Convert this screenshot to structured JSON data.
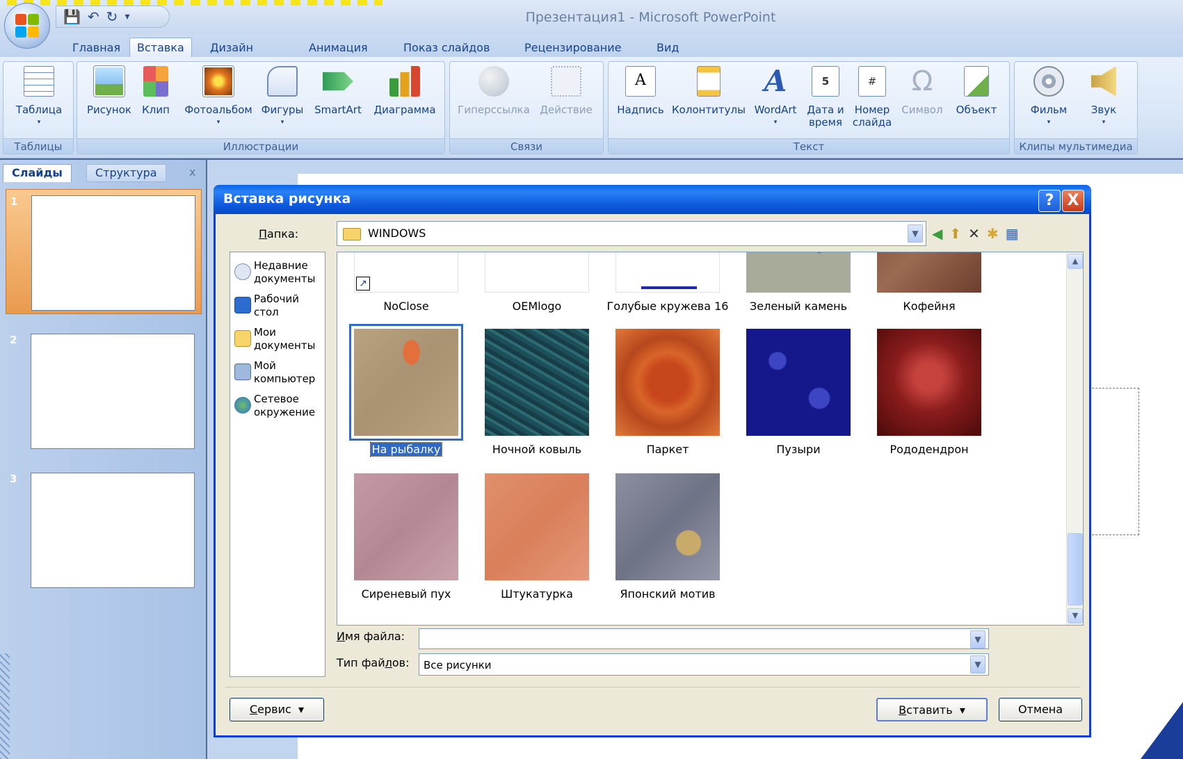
{
  "app": {
    "title": "Презентация1 - Microsoft PowerPoint"
  },
  "qat": {
    "save_icon": "save-icon",
    "undo_icon": "undo-icon",
    "redo_icon": "redo-icon",
    "customize": "▾"
  },
  "tabs": [
    {
      "label": "Главная",
      "active": false
    },
    {
      "label": "Вставка",
      "active": true
    },
    {
      "label": "Дизайн",
      "active": false
    },
    {
      "label": "Анимация",
      "active": false
    },
    {
      "label": "Показ слайдов",
      "active": false
    },
    {
      "label": "Рецензирование",
      "active": false
    },
    {
      "label": "Вид",
      "active": false
    }
  ],
  "ribbon": {
    "groups": [
      {
        "label": "Таблицы",
        "buttons": [
          {
            "label": "Таблица",
            "icon": "table-icon"
          }
        ]
      },
      {
        "label": "Иллюстрации",
        "buttons": [
          {
            "label": "Рисунок",
            "icon": "picture-icon"
          },
          {
            "label": "Клип",
            "icon": "clip-icon"
          },
          {
            "label": "Фотоальбом",
            "icon": "photo-album-icon"
          },
          {
            "label": "Фигуры",
            "icon": "shapes-icon"
          },
          {
            "label": "SmartArt",
            "icon": "smartart-icon"
          },
          {
            "label": "Диаграмма",
            "icon": "chart-icon"
          }
        ]
      },
      {
        "label": "Связи",
        "buttons": [
          {
            "label": "Гиперссылка",
            "icon": "hyperlink-icon"
          },
          {
            "label": "Действие",
            "icon": "action-icon"
          }
        ]
      },
      {
        "label": "Текст",
        "buttons": [
          {
            "label": "Надпись",
            "icon": "textbox-icon"
          },
          {
            "label": "Колонтитулы",
            "icon": "header-footer-icon"
          },
          {
            "label": "WordArt",
            "icon": "wordart-icon"
          },
          {
            "label": "Дата и время",
            "icon": "date-time-icon"
          },
          {
            "label": "Номер слайда",
            "icon": "slide-number-icon"
          },
          {
            "label": "Символ",
            "icon": "symbol-icon"
          },
          {
            "label": "Объект",
            "icon": "object-icon"
          }
        ]
      },
      {
        "label": "Клипы мультимедиа",
        "buttons": [
          {
            "label": "Фильм",
            "icon": "movie-icon"
          },
          {
            "label": "Звук",
            "icon": "sound-icon"
          }
        ]
      }
    ],
    "text_labels": {
      "date_line1": "Дата и",
      "date_line2": "время",
      "num_line1": "Номер",
      "num_line2": "слайда"
    }
  },
  "slides_pane": {
    "tab_slides": "Слайды",
    "tab_outline": "Структура",
    "close": "x",
    "slides": [
      "1",
      "2",
      "3"
    ]
  },
  "dialog": {
    "title": "Вставка рисунка",
    "help": "?",
    "close": "X",
    "folder_label_u": "П",
    "folder_label_rest": "апка:",
    "folder_value": "WINDOWS",
    "places": [
      {
        "label": "Недавние документы",
        "icon": "recent-docs-icon"
      },
      {
        "label": "Рабочий стол",
        "icon": "desktop-icon"
      },
      {
        "label": "Мои документы",
        "icon": "my-documents-icon"
      },
      {
        "label": "Мой компьютер",
        "icon": "my-computer-icon"
      },
      {
        "label": "Сетевое окружение",
        "icon": "network-icon"
      }
    ],
    "files": [
      {
        "name": "NoClose"
      },
      {
        "name": "OEMlogo"
      },
      {
        "name": "Голубые кружева 16"
      },
      {
        "name": "Зеленый камень"
      },
      {
        "name": "Кофейня"
      },
      {
        "name": "На рыбалку",
        "selected": true
      },
      {
        "name": "Ночной ковыль"
      },
      {
        "name": "Паркет"
      },
      {
        "name": "Пузыри"
      },
      {
        "name": "Рододендрон"
      },
      {
        "name": "Сиреневый пух"
      },
      {
        "name": "Штукатурка"
      },
      {
        "name": "Японский мотив"
      }
    ],
    "filename_label_u": "И",
    "filename_label_rest": "мя файла:",
    "filename_value": "",
    "filetype_label_a": "Тип фай",
    "filetype_label_u": "л",
    "filetype_label_b": "ов:",
    "filetype_value": "Все рисунки",
    "service_u": "С",
    "service_rest": "ервис",
    "insert_u": "В",
    "insert_rest": "ставить",
    "cancel": "Отмена"
  }
}
